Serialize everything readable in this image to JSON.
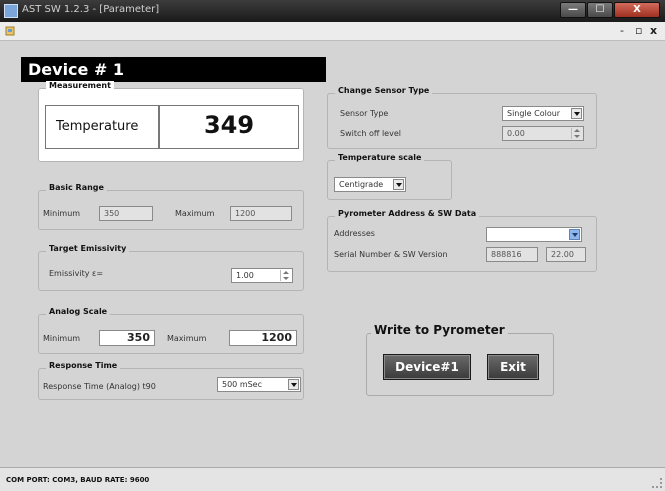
{
  "window": {
    "title": "AST SW 1.2.3 - [Parameter]",
    "min_glyph": "—",
    "max_glyph": "☐",
    "close_glyph": "X"
  },
  "mdi_controls": {
    "minimize": "-",
    "restore": "▫",
    "close": "x"
  },
  "device": {
    "title": "Device # 1"
  },
  "measurement": {
    "label": "Measurement",
    "name": "Temperature",
    "value": "349"
  },
  "basic_range": {
    "label": "Basic Range",
    "min_label": "Minimum",
    "min_value": "350",
    "max_label": "Maximum",
    "max_value": "1200"
  },
  "target_emissivity": {
    "label": "Target Emissivity",
    "field_label": "Emissivity ε=",
    "value": "1.00"
  },
  "analog_scale": {
    "label": "Analog Scale",
    "min_label": "Minimum",
    "min_value": "350",
    "max_label": "Maximum",
    "max_value": "1200"
  },
  "response_time": {
    "label": "Response Time",
    "field_label": "Response Time (Analog) t90",
    "value": "500 mSec"
  },
  "change_sensor_type": {
    "label": "Change Sensor Type",
    "type_label": "Sensor Type",
    "type_value": "Single Colour",
    "switch_off_label": "Switch off level",
    "switch_off_value": "0.00"
  },
  "temperature_scale": {
    "label": "Temperature scale",
    "value": "Centigrade"
  },
  "pyrometer": {
    "label": "Pyrometer Address & SW Data",
    "addresses_label": "Addresses",
    "addresses_value": "",
    "serial_label": "Serial Number & SW Version",
    "serial_value": "888816",
    "sw_version": "22.00"
  },
  "write": {
    "label": "Write to Pyrometer",
    "device_button": "Device#1",
    "exit_button": "Exit"
  },
  "status": {
    "text": "COM PORT: COM3, BAUD RATE: 9600"
  },
  "colors": {
    "title_bar": "#1f1f1f",
    "device_header": "#000000",
    "button_dark": "#4a4a4a",
    "close_red": "#c0392b",
    "background": "#d4d4d4"
  }
}
